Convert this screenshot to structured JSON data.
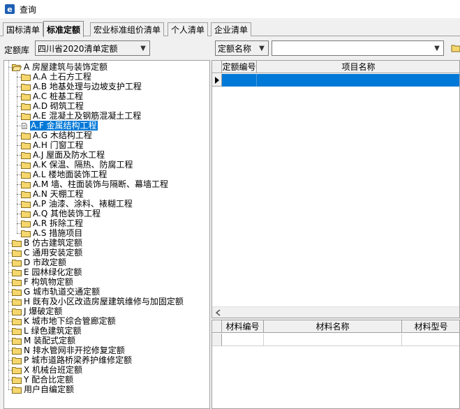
{
  "window": {
    "title": "查询"
  },
  "tabs": [
    {
      "label": "国标清单",
      "active": false
    },
    {
      "label": "标准定额",
      "active": true
    },
    {
      "label": "宏业标准组价清单",
      "active": false
    },
    {
      "label": "个人清单",
      "active": false
    },
    {
      "label": "企业清单",
      "active": false
    }
  ],
  "toolbar": {
    "library_label": "定额库",
    "library_value": "四川省2020清单定额",
    "search_mode_value": "定额名称",
    "search_value": ""
  },
  "tree": {
    "root_a": "A 房屋建筑与装饰定额",
    "a_children": [
      "A.A 土石方工程",
      "A.B 地基处理与边坡支护工程",
      "A.C 桩基工程",
      "A.D 砌筑工程",
      "A.E 混凝土及钢筋混凝土工程",
      "A.F 金属结构工程",
      "A.G 木结构工程",
      "A.H 门窗工程",
      "A.J 屋面及防水工程",
      "A.K 保温、隔热、防腐工程",
      "A.L 楼地面装饰工程",
      "A.M 墙、柱面装饰与隔断、幕墙工程",
      "A.N 天棚工程",
      "A.P 油漆、涂料、裱糊工程",
      "A.Q 其他装饰工程",
      "A.R 拆除工程",
      "A.S 措施项目"
    ],
    "selected_child_index": 5,
    "top_level": [
      "B 仿古建筑定额",
      "C 通用安装定额",
      "D 市政定额",
      "E 园林绿化定额",
      "F 构筑物定额",
      "G 城市轨道交通定额",
      "H 既有及小区改造房屋建筑维修与加固定额",
      "J 爆破定额",
      "K 城市地下综合管廊定额",
      "L 绿色建筑定额",
      "M 装配式定额",
      "N 排水管网非开挖修复定额",
      "P 城市道路桥梁养护维修定额",
      "X 机械台班定额",
      "Y 配合比定额",
      "用户自编定额"
    ]
  },
  "quota_grid": {
    "columns": [
      "定额编号",
      "项目名称"
    ]
  },
  "material_grid": {
    "columns": [
      "材料编号",
      "材料名称",
      "材料型号"
    ]
  },
  "colors": {
    "selection": "#0078d7",
    "folder": "#f5d76e"
  }
}
